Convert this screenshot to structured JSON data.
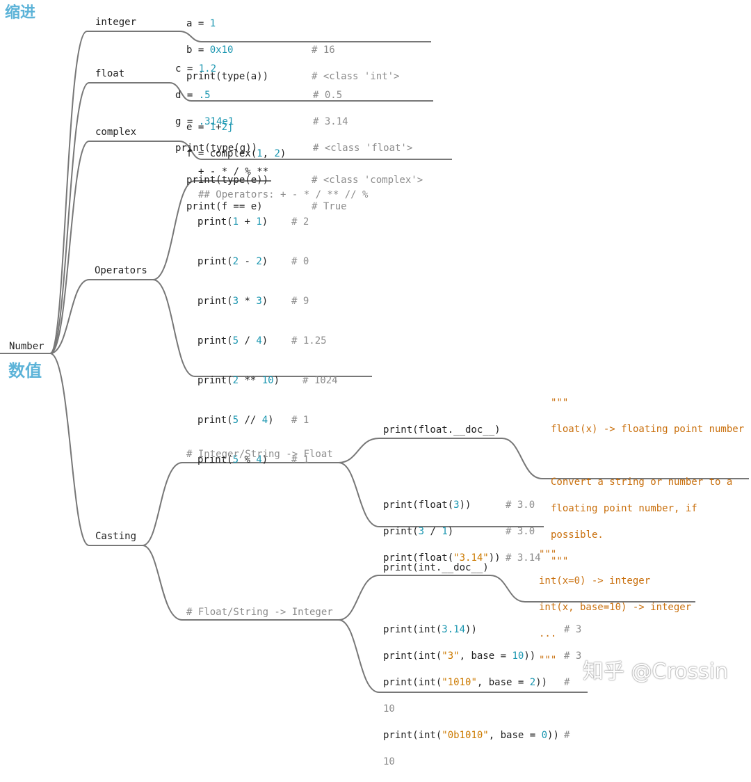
{
  "labels": {
    "indent": "缩进",
    "numbers": "数值",
    "root": "Number",
    "integer": "integer",
    "float": "float",
    "complex": "complex",
    "operators": "Operators",
    "casting": "Casting",
    "to_float": "# Integer/String -> Float",
    "to_int": "# Float/String -> Integer",
    "watermark": "知乎 @Crossin"
  },
  "integer": {
    "l1": {
      "a": "a = ",
      "b": "1"
    },
    "l2": {
      "a": "b = ",
      "b": "0x10",
      "c": "# 16"
    },
    "l3": {
      "a": "print(type(a))",
      "c": "# <class 'int'>"
    }
  },
  "float": {
    "l1": {
      "a": "c = ",
      "b": "1.2"
    },
    "l2": {
      "a": "d = ",
      "b": ".5",
      "c": "# 0.5"
    },
    "l3": {
      "a": "g = ",
      "b": ".314e1",
      "c": "# 3.14"
    },
    "l4": {
      "a": "print(type(g))",
      "c": "# <class 'float'>"
    }
  },
  "complex": {
    "l1": {
      "a": "e = ",
      "b": "1",
      "op": "+",
      "d": "2j"
    },
    "l2": {
      "a": "f = complex(",
      "b": "1",
      "op": ", ",
      "d": "2",
      "e": ")"
    },
    "l3": {
      "a": "print(type(e))",
      "c": "# <class 'complex'>"
    },
    "l4": {
      "a": "print(f == e)",
      "c": "# True"
    }
  },
  "operators": {
    "header": "+ - * / % **",
    "comment": "## Operators: + - * / ** // %",
    "lines": [
      {
        "a": "print(",
        "x": "1",
        "op": " + ",
        "y": "1",
        "e": ")",
        "c": "# 2"
      },
      {
        "a": "print(",
        "x": "2",
        "op": " - ",
        "y": "2",
        "e": ")",
        "c": "# 0"
      },
      {
        "a": "print(",
        "x": "3",
        "op": " * ",
        "y": "3",
        "e": ")",
        "c": "# 9"
      },
      {
        "a": "print(",
        "x": "5",
        "op": " / ",
        "y": "4",
        "e": ")",
        "c": "# 1.25"
      },
      {
        "a": "print(",
        "x": "2",
        "op": " ** ",
        "y": "10",
        "e": ")",
        "c": "# 1024"
      },
      {
        "a": "print(",
        "x": "5",
        "op": " // ",
        "y": "4",
        "e": ")",
        "c": "# 1"
      },
      {
        "a": "print(",
        "x": "5",
        "op": " % ",
        "y": "4",
        "e": ")",
        "c": "# 1"
      }
    ]
  },
  "to_float": {
    "doc_call": "print(float.__doc__)",
    "doc": [
      "\"\"\"",
      "float(x) -> floating point number",
      "",
      "Convert a string or number to a",
      "floating point number, if",
      "possible.",
      "\"\"\""
    ],
    "l1": {
      "a": "print(float(",
      "x": "3",
      "e": "))",
      "c": "# 3.0"
    },
    "l2": {
      "a": "print(",
      "x": "3",
      "op": " / ",
      "y": "1",
      "e": ")",
      "c": "# 3.0"
    },
    "l3": {
      "a": "print(float(",
      "s": "\"3.14\"",
      "e": "))",
      "c": "# 3.14"
    }
  },
  "to_int": {
    "doc_call": "print(int.__doc__)",
    "doc": [
      "\"\"\"",
      "int(x=0) -> integer",
      "int(x, base=10) -> integer",
      "...",
      "\"\"\""
    ],
    "l1": {
      "a": "print(int(",
      "x": "3.14",
      "e": "))",
      "c": "# 3"
    },
    "l2": {
      "a": "print(int(",
      "s": "\"3\"",
      "m": ", base = ",
      "n": "10",
      "e": "))",
      "c": "# 3"
    },
    "l3": {
      "a": "print(int(",
      "s": "\"1010\"",
      "m": ", base = ",
      "n": "2",
      "e": "))",
      "c": "#"
    },
    "l3b": "10",
    "l4": {
      "a": "print(int(",
      "s": "\"0b1010\"",
      "m": ", base = ",
      "n": "0",
      "e": "))",
      "c": "#"
    },
    "l4b": "10"
  }
}
